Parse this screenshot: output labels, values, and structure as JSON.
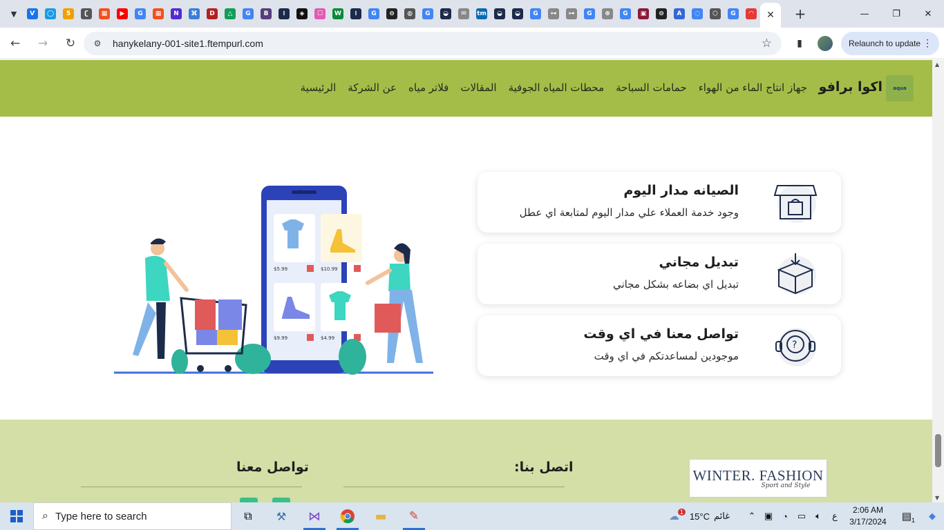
{
  "browser": {
    "tab_favicons": [
      {
        "icon": "letter-s-circle-icon",
        "color": "#1a73e8",
        "glyph": "Ѵ"
      },
      {
        "icon": "circle-o-icon",
        "color": "#1a9be8",
        "glyph": "◯"
      },
      {
        "icon": "number-5-icon",
        "color": "#f0a000",
        "glyph": "5"
      },
      {
        "icon": "lambda-icon",
        "color": "#555555",
        "glyph": "ʗ"
      },
      {
        "icon": "microsoft-icon",
        "color": "#f25022",
        "glyph": "▦"
      },
      {
        "icon": "youtube-icon",
        "color": "#ff0000",
        "glyph": "▶"
      },
      {
        "icon": "google-icon",
        "color": "#4285f4",
        "glyph": "G"
      },
      {
        "icon": "microsoft-icon",
        "color": "#f25022",
        "glyph": "▦"
      },
      {
        "icon": "dotnet-icon",
        "color": "#512bd4",
        "glyph": "N"
      },
      {
        "icon": "tool-icon",
        "color": "#3b7fd6",
        "glyph": "ⴼ"
      },
      {
        "icon": "d-box-icon",
        "color": "#b22222",
        "glyph": "D"
      },
      {
        "icon": "drive-icon",
        "color": "#0f9d58",
        "glyph": "△"
      },
      {
        "icon": "google-icon",
        "color": "#4285f4",
        "glyph": "G"
      },
      {
        "icon": "bootstrap-icon",
        "color": "#563d7c",
        "glyph": "B"
      },
      {
        "icon": "dots-box-icon",
        "color": "#1c2b4a",
        "glyph": "⁝"
      },
      {
        "icon": "codepen-icon",
        "color": "#111111",
        "glyph": "◈"
      },
      {
        "icon": "pink-box-icon",
        "color": "#e05bb4",
        "glyph": "☐"
      },
      {
        "icon": "w-icon",
        "color": "#0a8a3a",
        "glyph": "W"
      },
      {
        "icon": "dots-box-icon",
        "color": "#1c2b4a",
        "glyph": "⁝"
      },
      {
        "icon": "google-icon",
        "color": "#4285f4",
        "glyph": "G"
      },
      {
        "icon": "steering-icon",
        "color": "#222222",
        "glyph": "⊖"
      },
      {
        "icon": "globe-icon",
        "color": "#555555",
        "glyph": "◍"
      },
      {
        "icon": "google-icon",
        "color": "#4285f4",
        "glyph": "G"
      },
      {
        "icon": "shield-icon",
        "color": "#1c2b4a",
        "glyph": "◒"
      },
      {
        "icon": "mail-icon",
        "color": "#888888",
        "glyph": "✉"
      },
      {
        "icon": "tm-icon",
        "color": "#0b6ab3",
        "glyph": "tm"
      },
      {
        "icon": "shield-icon",
        "color": "#1c2b4a",
        "glyph": "◒"
      },
      {
        "icon": "shield-icon",
        "color": "#1c2b4a",
        "glyph": "◒"
      },
      {
        "icon": "google-icon",
        "color": "#4285f4",
        "glyph": "G"
      },
      {
        "icon": "car-icon",
        "color": "#888888",
        "glyph": "⊶"
      },
      {
        "icon": "car-icon",
        "color": "#888888",
        "glyph": "⊶"
      },
      {
        "icon": "google-icon",
        "color": "#4285f4",
        "glyph": "G"
      },
      {
        "icon": "plane-icon",
        "color": "#888888",
        "glyph": "⊕"
      },
      {
        "icon": "google-icon",
        "color": "#4285f4",
        "glyph": "G"
      },
      {
        "icon": "graduation-icon",
        "color": "#8b1a3a",
        "glyph": "▣"
      },
      {
        "icon": "steering-icon",
        "color": "#222222",
        "glyph": "⊖"
      },
      {
        "icon": "a-circle-icon",
        "color": "#3367d6",
        "glyph": "A"
      },
      {
        "icon": "loading-icon",
        "color": "#4285f4",
        "glyph": "◌"
      },
      {
        "icon": "chrome-shield-icon",
        "color": "#555555",
        "glyph": "⬡"
      },
      {
        "icon": "google-icon",
        "color": "#4285f4",
        "glyph": "G"
      },
      {
        "icon": "rainbow-icon",
        "color": "#e53935",
        "glyph": "◠"
      }
    ],
    "active_tab_close": "✕",
    "new_tab": "+",
    "window": {
      "minimize": "—",
      "restore": "❐",
      "close": "✕"
    },
    "url": "hanykelany-001-site1.ftempurl.com",
    "relaunch_label": "Relaunch to update"
  },
  "site": {
    "logo_text": "aqua",
    "brand": "اكوا برافو",
    "menu": [
      "الرئيسية",
      "عن الشركة",
      "فلاتر مياه",
      "المقالات",
      "محطات المياه الجوفية",
      "حمامات السباحة",
      "جهاز انتاج الماء من الهواء"
    ],
    "features": [
      {
        "title": "الصيانه مدار اليوم",
        "desc": "وجود خدمة العملاء علي مدار اليوم لمتابعة اي عطل",
        "icon": "store-icon"
      },
      {
        "title": "تبديل مجاني",
        "desc": "تبديل اي بضاعه بشكل مجاني",
        "icon": "box-icon"
      },
      {
        "title": "تواصل معنا في اي وقت",
        "desc": "موجودين لمساعدتكم في اي وقت",
        "icon": "support-icon"
      }
    ],
    "illustration": {
      "prices": [
        "$5.99",
        "$10.99",
        "$9.99",
        "$4.99"
      ]
    },
    "footer": {
      "logo_title": "WINTER. FASHION",
      "logo_sub": "Sport and Style",
      "contact_heading": "اتصل بنا:",
      "follow_heading": "تواصل معنا"
    }
  },
  "taskbar": {
    "search_placeholder": "Type here to search",
    "weather_temp": "15°C",
    "weather_label": "غائم",
    "weather_badge": "1",
    "language": "ع",
    "time": "2:06 AM",
    "date": "3/17/2024",
    "notification_count": "1"
  }
}
